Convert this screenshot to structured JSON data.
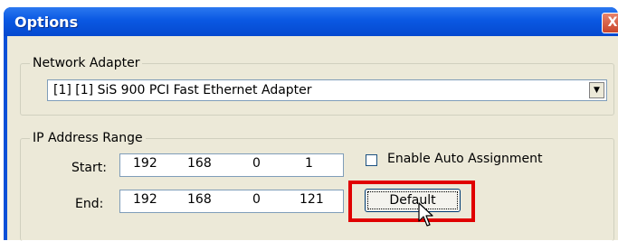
{
  "window": {
    "title": "Options",
    "close_glyph": "X"
  },
  "network_adapter": {
    "group_label": "Network Adapter",
    "selected": "[1] [1] SiS 900 PCI Fast Ethernet Adapter"
  },
  "ip_range": {
    "group_label": "IP Address Range",
    "start_label": "Start:",
    "start": [
      "192",
      "168",
      "0",
      "1"
    ],
    "end_label": "End:",
    "end": [
      "192",
      "168",
      "0",
      "121"
    ],
    "auto_assign_label": "Enable Auto Assignment",
    "auto_assign_checked": false,
    "default_button": "Default"
  },
  "colors": {
    "titlebar": "#0a58e2",
    "highlight": "#e00000",
    "face": "#ece9d8"
  },
  "icons": {
    "close": "close-icon",
    "dropdown": "chevron-down-icon",
    "cursor": "mouse-pointer-icon"
  }
}
